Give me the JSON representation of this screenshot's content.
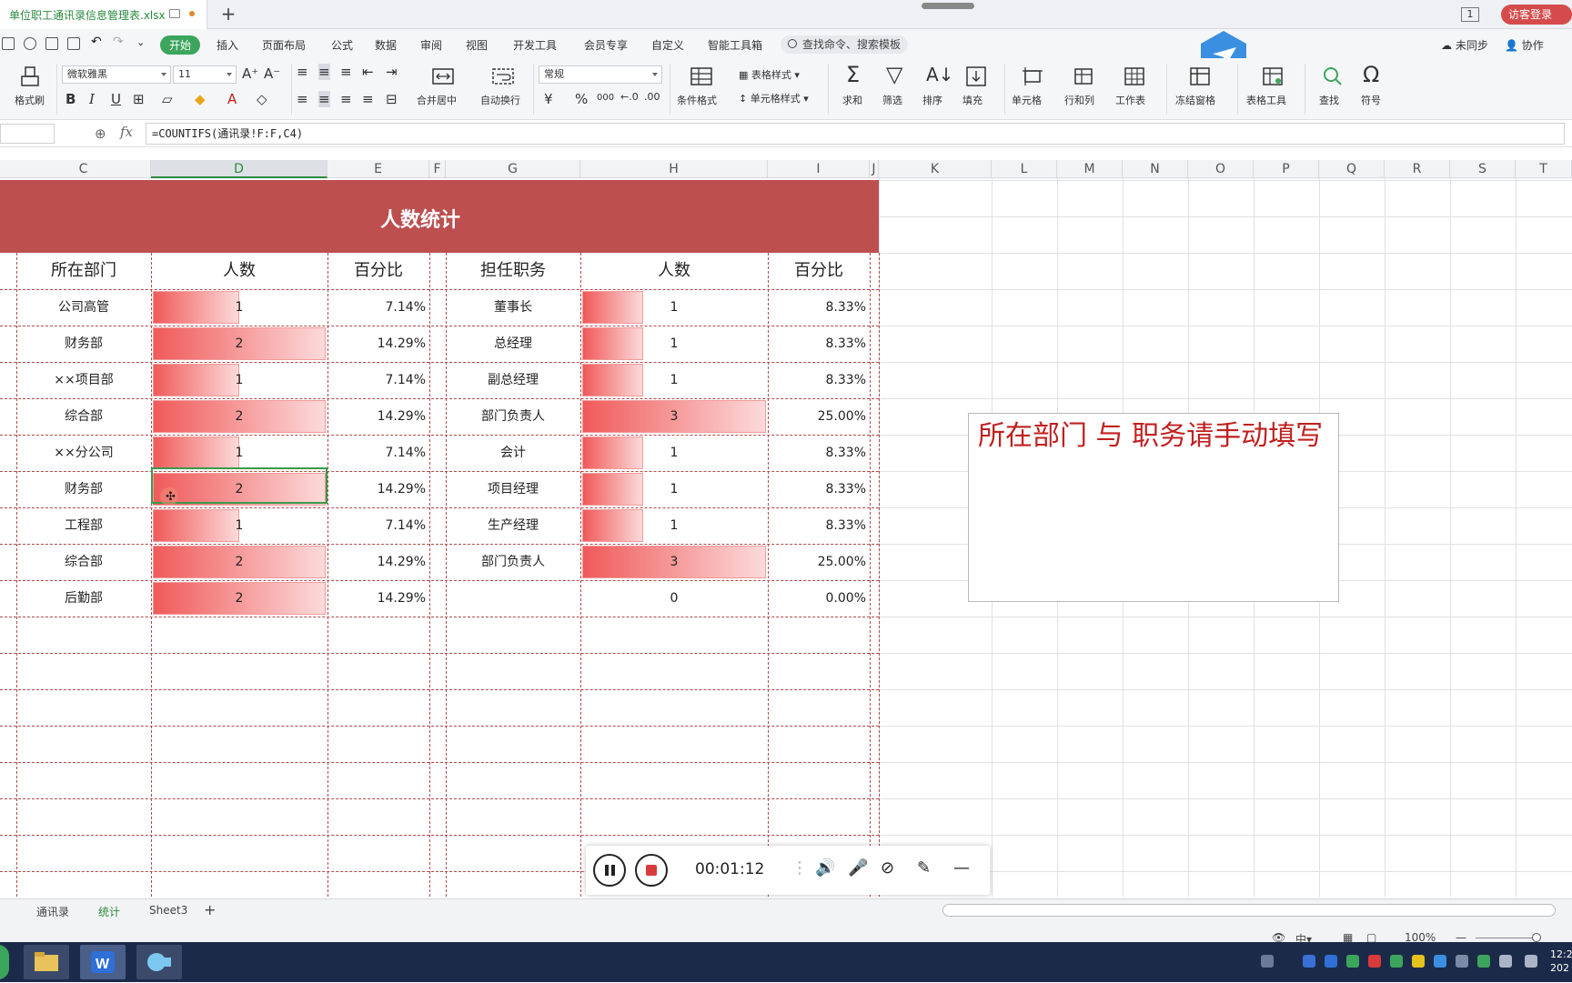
{
  "titlebar": {
    "file_tab": "单位职工通讯录信息管理表.xlsx",
    "login_button": "访客登录",
    "window_badge": "1"
  },
  "menubar": {
    "items": [
      "开始",
      "插入",
      "页面布局",
      "公式",
      "数据",
      "审阅",
      "视图",
      "开发工具",
      "会员专享",
      "自定义",
      "智能工具箱"
    ],
    "active_index": 0,
    "search_placeholder": "查找命令、搜索模板",
    "sync_label": "未同步",
    "collab_label": "协作"
  },
  "ribbon": {
    "font_name": "微软雅黑",
    "font_size": "11",
    "number_format": "常规",
    "format_painter": "格式刷",
    "merge_center": "合并居中",
    "wrap_text": "自动换行",
    "table_style": "表格样式",
    "cell_style": "单元格样式",
    "conditional_format": "条件格式",
    "sum": "求和",
    "filter": "筛选",
    "sort": "排序",
    "fill": "填充",
    "cell": "单元格",
    "row_col": "行和列",
    "worksheet": "工作表",
    "freeze": "冻结窗格",
    "table_tools": "表格工具",
    "find": "查找",
    "symbol": "符号",
    "bold": "B",
    "italic": "I",
    "underline": "U",
    "currency": "¥",
    "percent": "%",
    "thousands": "000"
  },
  "formula_bar": {
    "fx": "fx",
    "formula": "=COUNTIFS(通讯录!F:F,C4)"
  },
  "columns": [
    "C",
    "D",
    "E",
    "F",
    "G",
    "H",
    "I",
    "J",
    "K",
    "L",
    "M",
    "N",
    "O",
    "P",
    "Q",
    "R",
    "S",
    "T"
  ],
  "active_column": "D",
  "table": {
    "title": "人数统计",
    "dept_headers": [
      "所在部门",
      "人数",
      "百分比"
    ],
    "role_headers": [
      "担任职务",
      "人数",
      "百分比"
    ],
    "dept_rows": [
      {
        "name": "公司高管",
        "count": 1,
        "pct": "7.14%"
      },
      {
        "name": "财务部",
        "count": 2,
        "pct": "14.29%"
      },
      {
        "name": "××项目部",
        "count": 1,
        "pct": "7.14%"
      },
      {
        "name": "综合部",
        "count": 2,
        "pct": "14.29%"
      },
      {
        "name": "××分公司",
        "count": 1,
        "pct": "7.14%"
      },
      {
        "name": "财务部",
        "count": 2,
        "pct": "14.29%"
      },
      {
        "name": "工程部",
        "count": 1,
        "pct": "7.14%"
      },
      {
        "name": "综合部",
        "count": 2,
        "pct": "14.29%"
      },
      {
        "name": "后勤部",
        "count": 2,
        "pct": "14.29%"
      }
    ],
    "role_rows": [
      {
        "name": "董事长",
        "count": 1,
        "pct": "8.33%"
      },
      {
        "name": "总经理",
        "count": 1,
        "pct": "8.33%"
      },
      {
        "name": "副总经理",
        "count": 1,
        "pct": "8.33%"
      },
      {
        "name": "部门负责人",
        "count": 3,
        "pct": "25.00%"
      },
      {
        "name": "会计",
        "count": 1,
        "pct": "8.33%"
      },
      {
        "name": "项目经理",
        "count": 1,
        "pct": "8.33%"
      },
      {
        "name": "生产经理",
        "count": 1,
        "pct": "8.33%"
      },
      {
        "name": "部门负责人",
        "count": 3,
        "pct": "25.00%"
      },
      {
        "name": "",
        "count": 0,
        "pct": "0.00%"
      }
    ],
    "colors": {
      "title_band": "#bd4f4f",
      "bar_start": "#f05a5a",
      "bar_end": "#fcdada"
    }
  },
  "note": "所在部门 与 职务请手动填写",
  "recorder": {
    "time": "00:01:12"
  },
  "sheet_tabs": {
    "tabs": [
      "通讯录",
      "统计",
      "Sheet3"
    ],
    "active_index": 1
  },
  "status": {
    "zoom": "100%"
  },
  "taskbar": {
    "clock_time": "12:2",
    "clock_date": "202"
  }
}
